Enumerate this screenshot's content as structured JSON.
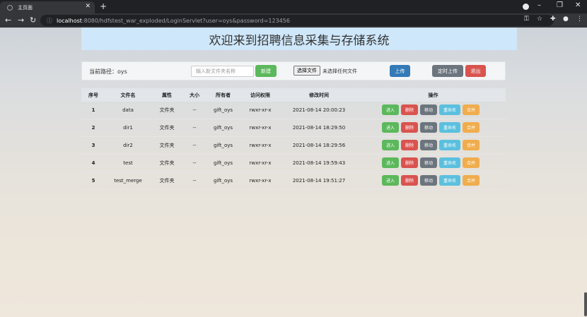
{
  "browser": {
    "tab_title": "主页面",
    "url_host": "localhost",
    "url_path": ":8080/hdfstest_war_exploded/LoginServlet?user=oys&password=123456"
  },
  "page": {
    "banner_title": "欢迎来到招聘信息采集与存储系统"
  },
  "toolbar": {
    "path_label": "当前路径：oys",
    "new_placeholder": "输入新文件夹名称",
    "new_button": "新建",
    "choose_file": "选择文件",
    "file_status": "未选择任何文件",
    "upload": "上传",
    "timed_upload": "定时上传",
    "logout": "退出"
  },
  "table": {
    "headers": {
      "no": "序号",
      "name": "文件名",
      "attr": "属性",
      "size": "大小",
      "owner": "所有者",
      "perm": "访问权限",
      "time": "修改时间",
      "ops": "操作"
    },
    "action_labels": {
      "enter": "进入",
      "delete": "删除",
      "move": "移动",
      "rename": "重命名",
      "merge": "合并"
    },
    "rows": [
      {
        "no": "1",
        "name": "data",
        "attr": "文件夹",
        "size": "--",
        "owner": "gift_oys",
        "perm": "rwxr-xr-x",
        "time": "2021-08-14 20:00:23"
      },
      {
        "no": "2",
        "name": "dir1",
        "attr": "文件夹",
        "size": "--",
        "owner": "gift_oys",
        "perm": "rwxr-xr-x",
        "time": "2021-08-14 18:29:50"
      },
      {
        "no": "3",
        "name": "dir2",
        "attr": "文件夹",
        "size": "--",
        "owner": "gift_oys",
        "perm": "rwxr-xr-x",
        "time": "2021-08-14 18:29:56"
      },
      {
        "no": "4",
        "name": "test",
        "attr": "文件夹",
        "size": "--",
        "owner": "gift_oys",
        "perm": "rwxr-xr-x",
        "time": "2021-08-14 19:59:43"
      },
      {
        "no": "5",
        "name": "test_merge",
        "attr": "文件夹",
        "size": "--",
        "owner": "gift_oys",
        "perm": "rwxr-xr-x",
        "time": "2021-08-14 19:51:27"
      }
    ]
  },
  "icons": {
    "back": "back-arrow-icon",
    "forward": "forward-arrow-icon",
    "reload": "reload-icon",
    "lock": "info-icon",
    "key": "key-icon",
    "star": "star-icon",
    "extensions": "puzzle-icon",
    "profile": "profile-icon",
    "menu": "kebab-menu-icon"
  }
}
